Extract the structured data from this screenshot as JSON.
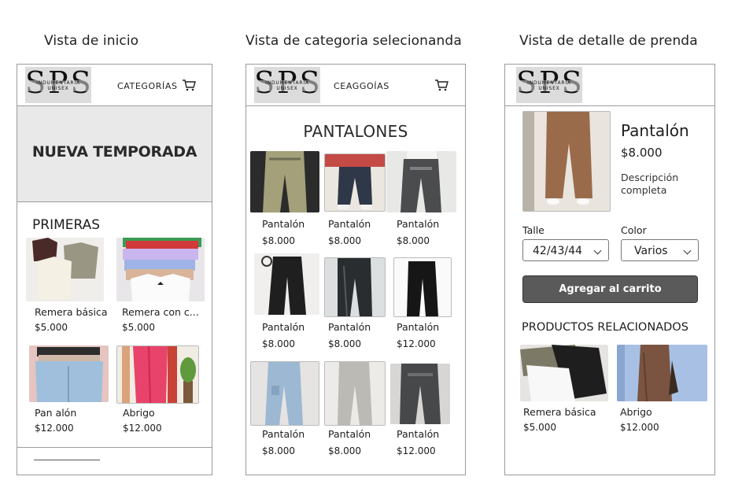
{
  "view_titles": {
    "home": "Vista de inicio",
    "category": "Vista de categoria selecionanda",
    "detail": "Vista de detalle de prenda"
  },
  "logo": {
    "letters": "SPS",
    "tagline": "INDUMENTARIA UNISEX"
  },
  "home": {
    "nav_label": "CATEGORÍAS",
    "banner": "NUEVA TEMPORADA",
    "section_title": "PRIMERAS",
    "products": [
      {
        "name": "Remera básica",
        "price": "$5.000"
      },
      {
        "name": "Remera con c...",
        "price": "$5.000"
      },
      {
        "name": "Pan alón",
        "price": "$12.000"
      },
      {
        "name": "Abrigo",
        "price": "$12.000"
      }
    ]
  },
  "category": {
    "nav_label": "CEAGGOÍAS",
    "title": "PANTALONES",
    "products": [
      {
        "name": "Pantalón",
        "price": "$8.000"
      },
      {
        "name": "Pantalón",
        "price": "$8.000"
      },
      {
        "name": "Pantalón",
        "price": "$8.000"
      },
      {
        "name": "Pantalón",
        "price": "$8.000"
      },
      {
        "name": "Pantalón",
        "price": "$8.000"
      },
      {
        "name": "Pantalón",
        "price": "$12.000"
      },
      {
        "name": "Pantalón",
        "price": "$8.000"
      },
      {
        "name": "Pantalón",
        "price": "$8.000"
      },
      {
        "name": "Pantalón",
        "price": "$12.000"
      }
    ]
  },
  "detail": {
    "name": "Pantalón",
    "price": "$8.000",
    "description": "Descripción completa",
    "size_label": "Talle",
    "size_value": "42/43/44",
    "color_label": "Color",
    "color_value": "Varios",
    "add_to_cart": "Agregar al carrito",
    "related_title": "PRODUCTOS RELACIONADOS",
    "related": [
      {
        "name": "Remera básica",
        "price": "$5.000"
      },
      {
        "name": "Abrigo",
        "price": "$12.000"
      }
    ]
  },
  "colors": {
    "border": "#9b9b9b",
    "banner_bg": "#e9e9e9",
    "button_bg": "#5a5a5a",
    "logo_bg": "#dcdcdc"
  },
  "icons": [
    "cart-icon",
    "chevron-down-icon"
  ]
}
